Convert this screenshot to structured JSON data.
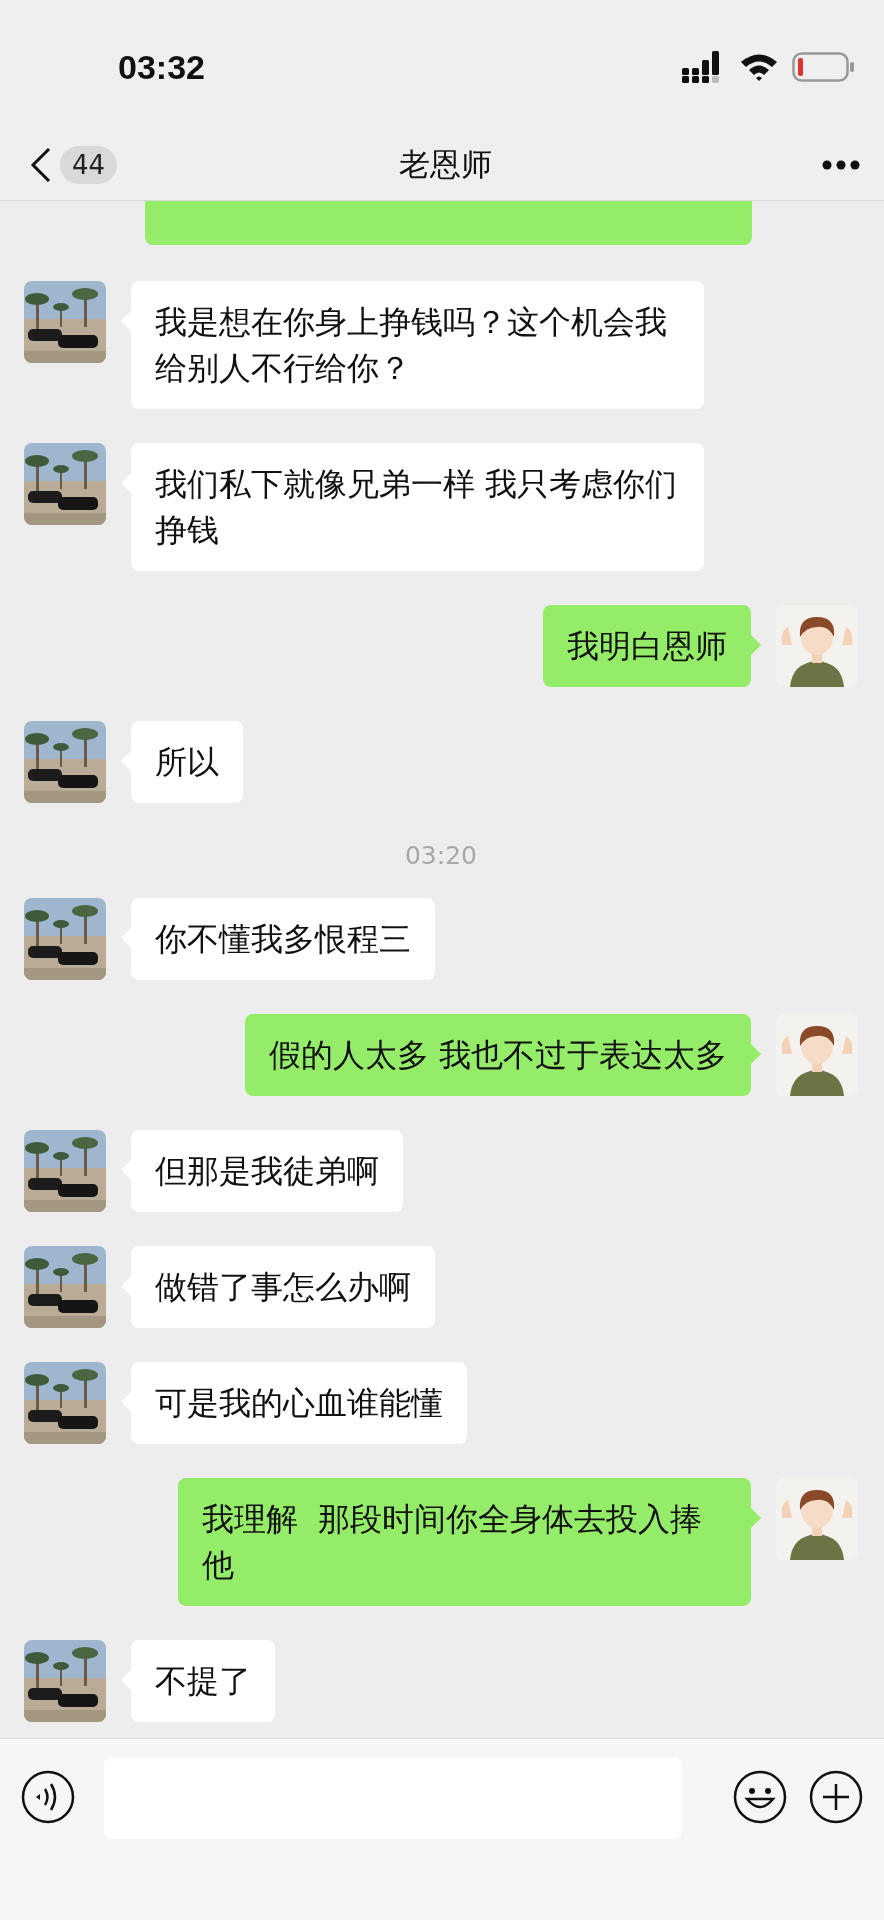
{
  "status_bar": {
    "time": "03:32"
  },
  "header": {
    "back_count": "44",
    "title": "老恩师"
  },
  "messages": [
    {
      "kind": "received",
      "text": "我是想在你身上挣钱吗？这个机会我给别人不行给你？"
    },
    {
      "kind": "received",
      "text": "我们私下就像兄弟一样 我只考虑你们挣钱"
    },
    {
      "kind": "sent",
      "text": "我明白恩师"
    },
    {
      "kind": "received",
      "text": "所以"
    },
    {
      "kind": "timestamp",
      "text": "03:20"
    },
    {
      "kind": "received",
      "text": "你不懂我多恨程三"
    },
    {
      "kind": "sent",
      "text": "假的人太多 我也不过于表达太多"
    },
    {
      "kind": "received",
      "text": "但那是我徒弟啊"
    },
    {
      "kind": "received",
      "text": "做错了事怎么办啊"
    },
    {
      "kind": "received",
      "text": "可是我的心血谁能懂"
    },
    {
      "kind": "sent",
      "text": "我理解  那段时间你全身体去投入捧他"
    },
    {
      "kind": "received",
      "text": "不提了"
    }
  ]
}
